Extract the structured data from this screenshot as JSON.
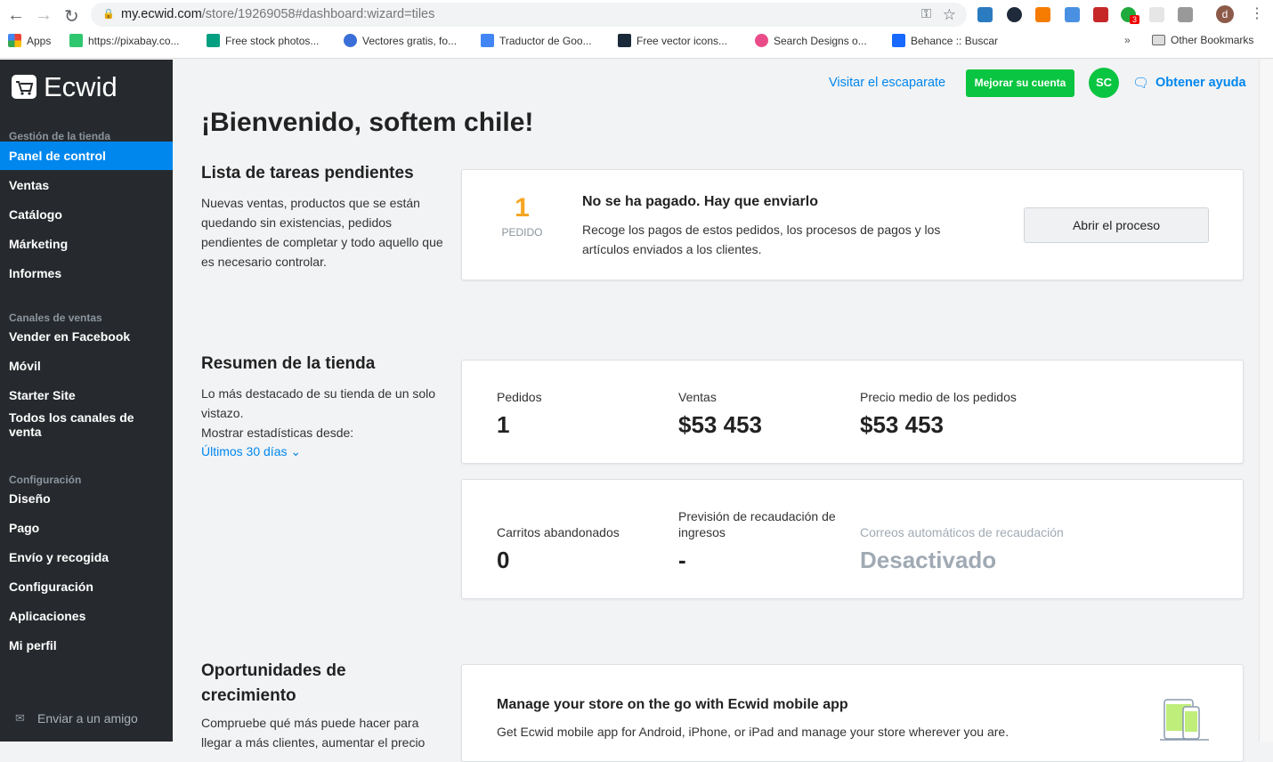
{
  "browser": {
    "url_host": "my.ecwid.com",
    "url_path": "/store/19269058#dashboard:wizard=tiles",
    "profile_initial": "d",
    "ext_badge": "3",
    "bookmarks": [
      "Apps",
      "https://pixabay.co...",
      "Free stock photos...",
      "Vectores gratis, fo...",
      "Traductor de Goo...",
      "Free vector icons...",
      "Search Designs o...",
      "Behance :: Buscar"
    ],
    "more": "»",
    "other_bookmarks": "Other Bookmarks"
  },
  "sidebar": {
    "logo": "Ecwid",
    "sections": [
      {
        "title": "Gestión de la tienda",
        "items": [
          "Panel de control",
          "Ventas",
          "Catálogo",
          "Márketing",
          "Informes"
        ]
      },
      {
        "title": "Canales de ventas",
        "items": [
          "Vender en Facebook",
          "Móvil",
          "Starter Site",
          "Todos los canales de venta"
        ]
      },
      {
        "title": "Configuración",
        "items": [
          "Diseño",
          "Pago",
          "Envío y recogida",
          "Configuración",
          "Aplicaciones",
          "Mi perfil"
        ]
      }
    ],
    "invite": "Enviar a un amigo"
  },
  "header": {
    "visit": "Visitar el escaparate",
    "upgrade": "Mejorar su cuenta",
    "avatar": "SC",
    "help": "Obtener ayuda",
    "accent": "#0087ee",
    "green": "#0ac541"
  },
  "main": {
    "title": "¡Bienvenido, softem chile!",
    "tasks": {
      "title": "Lista de tareas pendientes",
      "desc": "Nuevas ventas, productos que se están quedando sin existencias, pedidos pendientes de completar y todo aquello que es necesario controlar.",
      "count": "1",
      "count_label": "PEDIDO",
      "heading": "No se ha pagado. Hay que enviarlo",
      "text": "Recoge los pagos de estos pedidos, los procesos de pagos y los artículos enviados a los clientes.",
      "button": "Abrir el proceso"
    },
    "summary": {
      "title": "Resumen de la tienda",
      "desc": "Lo más destacado de su tienda de un solo vistazo.",
      "since": "Mostrar estadísticas desde:",
      "period": "Últimos 30 días",
      "stats": [
        {
          "label": "Pedidos",
          "value": "1"
        },
        {
          "label": "Ventas",
          "value": "$53 453"
        },
        {
          "label": "Precio medio de los pedidos",
          "value": "$53 453"
        }
      ],
      "stats2": [
        {
          "label": "Carritos abandonados",
          "value": "0"
        },
        {
          "label": "Previsión de recaudación de ingresos",
          "value": "-"
        },
        {
          "label": "Correos automáticos de recaudación",
          "value": "Desactivado"
        }
      ]
    },
    "growth": {
      "title": "Oportunidades de crecimiento",
      "desc": "Compruebe qué más puede hacer para llegar a más clientes, aumentar el precio",
      "card_title": "Manage your store on the go with Ecwid mobile app",
      "card_text": "Get Ecwid mobile app for Android, iPhone, or iPad and manage your store wherever you are."
    }
  }
}
